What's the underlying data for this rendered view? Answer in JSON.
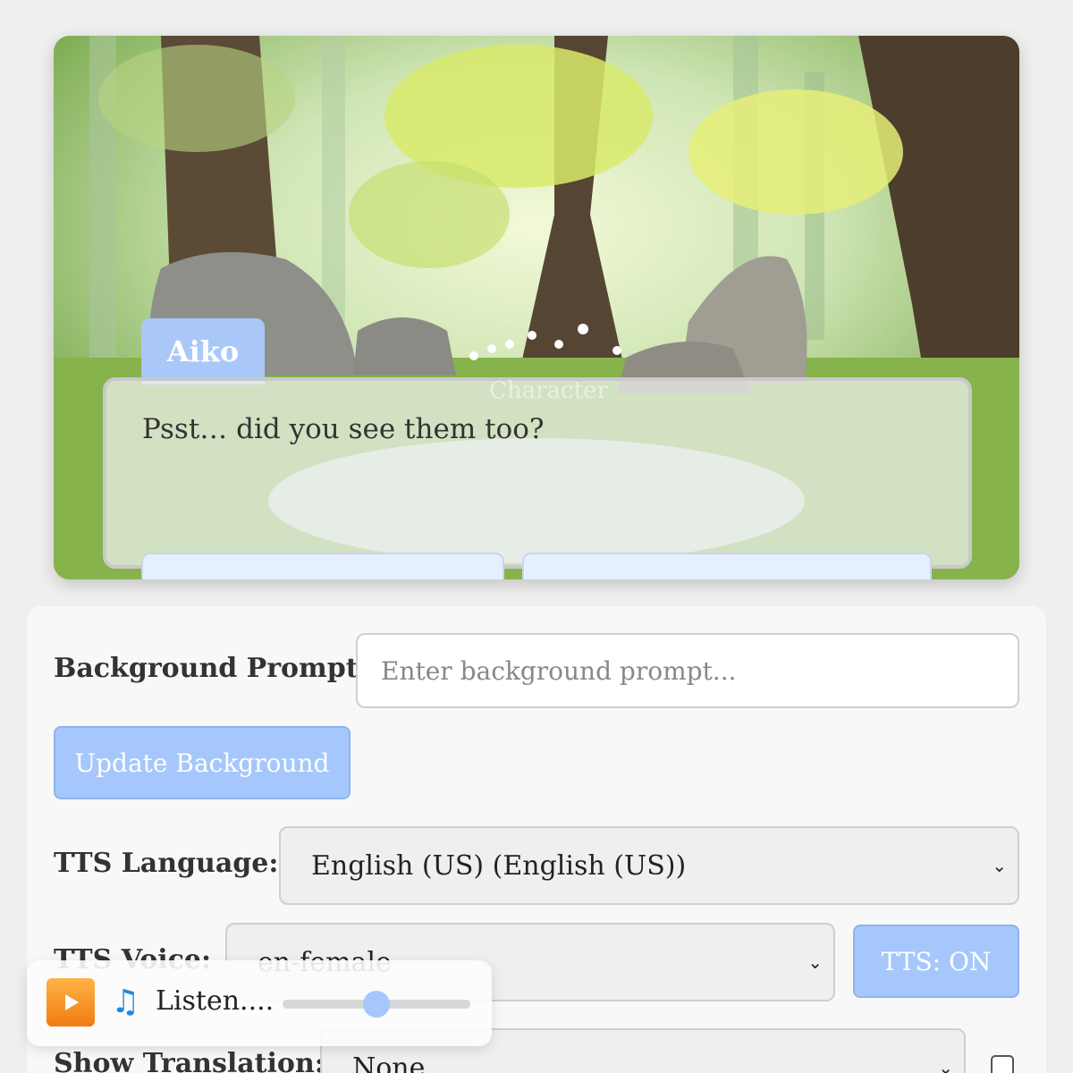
{
  "scene": {
    "speaker_name": "Aiko",
    "dialog_text": "Psst… did you see them too?",
    "ghost_text": "Character"
  },
  "controls": {
    "background_prompt_label": "Background Prompt:",
    "background_prompt_placeholder": "Enter background prompt...",
    "update_background_label": "Update Background",
    "tts_language_label": "TTS Language:",
    "tts_language_value": "English (US) (English (US))",
    "tts_voice_label": "TTS Voice:",
    "tts_voice_value": "en-female",
    "tts_toggle_label": "TTS: ON",
    "show_translation_label": "Show Translation:",
    "show_translation_value": "None"
  },
  "player": {
    "play_icon": "play-icon",
    "music_icon": "music-note-icon",
    "track_title": "Listen....",
    "volume_level": 0.5
  },
  "colors": {
    "accent": "#a6c7fb",
    "name_tag": "#a9c8f7",
    "play_button": "#f08a1c"
  }
}
